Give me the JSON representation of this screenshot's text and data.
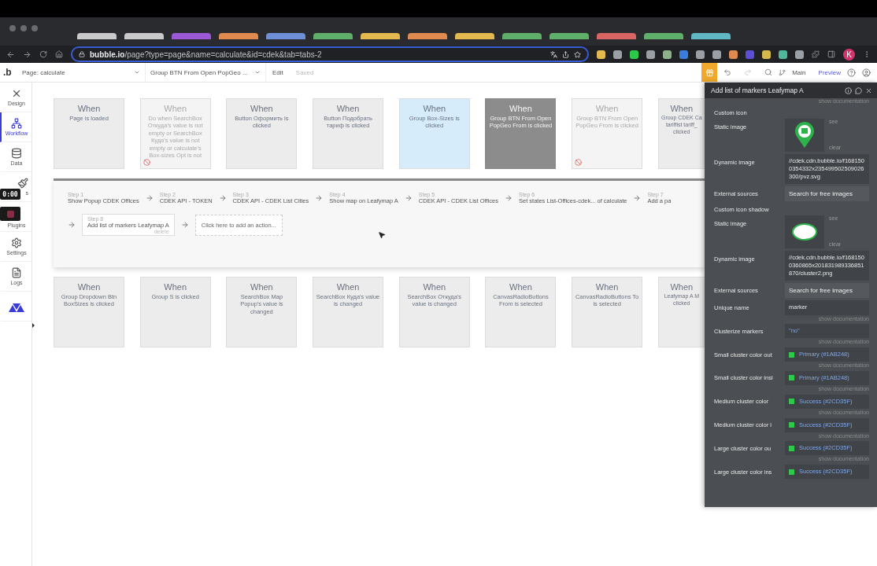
{
  "browser": {
    "tabs": [
      {
        "color": "#c9c9c9"
      },
      {
        "color": "#c9c9c9"
      },
      {
        "color": "#9b59d6"
      },
      {
        "color": "#e08a4f"
      },
      {
        "color": "#6f8fd6"
      },
      {
        "color": "#5fae6a"
      },
      {
        "color": "#e2b84f"
      },
      {
        "color": "#e08a4f"
      },
      {
        "color": "#e2b84f"
      },
      {
        "color": "#5fae6a"
      },
      {
        "color": "#5fae6a"
      },
      {
        "color": "#d96464"
      },
      {
        "color": "#5fae6a"
      },
      {
        "color": "#5fb8c4"
      }
    ],
    "url_host": "bubble.io",
    "url_path": "/page?type=page&name=calculate&id=cdek&tab=tabs-2",
    "extensions": [
      {
        "color": "#e2b84f"
      },
      {
        "color": "#9aa0a6"
      },
      {
        "color": "#2cc94a"
      },
      {
        "color": "#9aa0a6"
      },
      {
        "color": "#8fb08a"
      },
      {
        "color": "#3b7ddd"
      },
      {
        "color": "#9aa0a6"
      },
      {
        "color": "#9aa0a6"
      },
      {
        "color": "#e08a4f"
      },
      {
        "color": "#5b4fd6"
      },
      {
        "color": "#d6b84f"
      },
      {
        "color": "#4fb89a"
      },
      {
        "color": "#9aa0a6"
      }
    ],
    "avatar": "K"
  },
  "toolbar": {
    "logo": ".b",
    "page": "Page: calculate",
    "element": "Group BTN From Open PopGeo ...",
    "edit": "Edit",
    "saved": "Saved",
    "branch": "Main",
    "preview": "Preview"
  },
  "sidebar": {
    "items": [
      {
        "kind": "design",
        "label": "Design",
        "selected": false
      },
      {
        "kind": "workflow",
        "label": "Workflow",
        "selected": true
      },
      {
        "kind": "data",
        "label": "Data",
        "selected": false
      },
      {
        "kind": "styles",
        "label": "s",
        "selected": false
      },
      {
        "kind": "plugins",
        "label": "Plugins",
        "selected": false
      },
      {
        "kind": "settings",
        "label": "Settings",
        "selected": false
      },
      {
        "kind": "logs",
        "label": "Logs",
        "selected": false
      },
      {
        "kind": "logo",
        "selected": false
      }
    ]
  },
  "recorder": {
    "time": "0:00"
  },
  "events_top": [
    {
      "title": "When",
      "text": "Page is loaded",
      "selected": false,
      "disabled": false,
      "hovered": false
    },
    {
      "title": "When",
      "text": "Do when SearchBox Откуда's value is not empty or SearchBox Куда's value is not empty or calculate's Box-sizes Opt is not",
      "selected": false,
      "disabled": true,
      "hovered": false
    },
    {
      "title": "When",
      "text": "Button Оформить is clicked",
      "selected": false,
      "disabled": false,
      "hovered": false
    },
    {
      "title": "When",
      "text": "Button Подобрать тариф is clicked",
      "selected": false,
      "disabled": false,
      "hovered": false
    },
    {
      "title": "When",
      "text": "Group Box-Sizes is clicked",
      "selected": false,
      "disabled": false,
      "hovered": true
    },
    {
      "title": "When",
      "text": "Group BTN From Open PopGeo From is clicked",
      "selected": true,
      "disabled": false,
      "hovered": false
    },
    {
      "title": "When",
      "text": "Group BTN From Open PopGeo From is clicked",
      "selected": false,
      "disabled": true,
      "hovered": false
    },
    {
      "title": "When",
      "text": "Group CDEK Ca tariffist tariff_ clicked",
      "selected": false,
      "disabled": false,
      "hovered": false
    }
  ],
  "actions": {
    "rows": [
      {
        "steps": [
          {
            "label": "Step 1",
            "name": "Show Popup CDEK Offices",
            "selected": false
          },
          {
            "label": "Step 2",
            "name": "CDEK API - TOKEN",
            "selected": false
          },
          {
            "label": "Step 3",
            "name": "CDEK API - CDEK List Cities",
            "selected": false
          },
          {
            "label": "Step 4",
            "name": "Show map on Leafymap A",
            "selected": false
          },
          {
            "label": "Step 5",
            "name": "CDEK API - CDEK List Offices",
            "selected": false
          },
          {
            "label": "Step 6",
            "name": "Set states List-Offices-cdek... of calculate",
            "selected": false
          },
          {
            "label": "Step 7",
            "name": "Add a pa",
            "selected": false
          }
        ]
      },
      {
        "steps": [
          {
            "label": "Step 8",
            "name": "Add list of markers Leafymap A",
            "selected": true,
            "delete": "delete"
          }
        ],
        "add_action": "Click here to add an action..."
      }
    ]
  },
  "events_bottom": [
    {
      "title": "When",
      "text": "Group Dropdown Btn BoxSizes is clicked",
      "selected": false,
      "disabled": false,
      "hovered": false
    },
    {
      "title": "When",
      "text": "Group S is clicked",
      "selected": false,
      "disabled": false,
      "hovered": false
    },
    {
      "title": "When",
      "text": "SearchBox Map Popup's value is changed",
      "selected": false,
      "disabled": false,
      "hovered": false
    },
    {
      "title": "When",
      "text": "SearchBox Куда's value is changed",
      "selected": false,
      "disabled": false,
      "hovered": false
    },
    {
      "title": "When",
      "text": "SearchBox Откуда's value is changed",
      "selected": false,
      "disabled": false,
      "hovered": false
    },
    {
      "title": "When",
      "text": "CanvasRadioButtons From is selected",
      "selected": false,
      "disabled": false,
      "hovered": false
    },
    {
      "title": "When",
      "text": "CanvasRadioButtons To is selected",
      "selected": false,
      "disabled": false,
      "hovered": false
    },
    {
      "title": "When",
      "text": "Leafymap A M clicked",
      "selected": false,
      "disabled": false,
      "hovered": false
    }
  ],
  "panel": {
    "title": "Add list of markers Leafymap A",
    "top_note": "show documentation",
    "rows": [
      {
        "kind": "heading",
        "label": "Custom icon"
      },
      {
        "kind": "pin_image",
        "label": "Static image",
        "see": "see",
        "clear": "clear"
      },
      {
        "kind": "text",
        "label": "Dynamic image",
        "value": "//cdek.cdn.bubble.io/f1681500354332x235499502509026300/pvz.svg"
      },
      {
        "kind": "button",
        "label": "External sources",
        "value": "Search for free images"
      },
      {
        "kind": "heading",
        "label": "Custom icon shadow"
      },
      {
        "kind": "ellipse_image",
        "label": "Static image",
        "see": "see",
        "clear": "clear"
      },
      {
        "kind": "text",
        "label": "Dynamic image",
        "value": "//cdek.cdn.bubble.io/f1681500360865x201831989336851870/cluster2.png"
      },
      {
        "kind": "button",
        "label": "External sources",
        "value": "Search for free images"
      },
      {
        "kind": "field",
        "label": "Unique name",
        "value": "marker",
        "doc": "show documentation"
      },
      {
        "kind": "expression",
        "label": "Clusterize markers",
        "value": "\"no\"",
        "doc": "show documentation"
      },
      {
        "kind": "color",
        "label": "Small cluster color out",
        "value": "Primary (#1AB248)",
        "color": "#2cc94a",
        "doc": "show documentation"
      },
      {
        "kind": "color",
        "label": "Small cluster color insi",
        "value": "Primary (#1AB248)",
        "color": "#2cc94a",
        "doc": "show documentation"
      },
      {
        "kind": "color",
        "label": "Medium cluster color",
        "value": "Success (#2CD35F)",
        "color": "#2cc94a",
        "doc": "show documentation"
      },
      {
        "kind": "color",
        "label": "Medium cluster color i",
        "value": "Success (#2CD35F)",
        "color": "#2cc94a",
        "doc": "show documentation"
      },
      {
        "kind": "color",
        "label": "Large cluster color ou",
        "value": "Success (#2CD35F)",
        "color": "#2cc94a",
        "doc": "show documentation"
      },
      {
        "kind": "color",
        "label": "Large cluster color ins",
        "value": "Success (#2CD35F)",
        "color": "#2cc94a"
      }
    ]
  }
}
